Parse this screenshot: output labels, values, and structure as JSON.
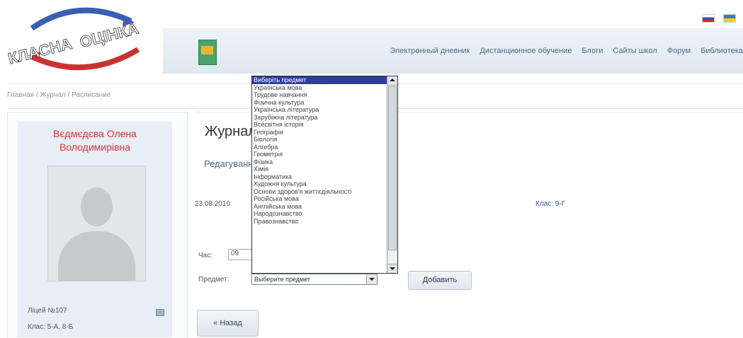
{
  "header": {
    "logo_text": [
      "КЛАСНА",
      "ОЦІНКА"
    ],
    "nav": [
      "Электронный дневник",
      "Дистанционное обучение",
      "Блоги",
      "Сайты школ",
      "Форум",
      "Библиотека"
    ]
  },
  "breadcrumb": "Главная / Журнал / Расписание",
  "profile": {
    "name": "Вєдмєдєва Олена Володимирівна",
    "school": "Ліцей №107",
    "classes": "Клас: 5-А, 8-Б"
  },
  "main": {
    "title": "Журнал",
    "subtitle": "Редагування",
    "date": "23.08.2010",
    "class_label": "Клас: 9-Г",
    "time_label": "Час:",
    "time_value": "09",
    "subject_label": "Предмет:",
    "subject_selected": "Выберите предмет",
    "add_button": "Добавить",
    "back_button": "« Назад"
  },
  "dropdown": {
    "options": [
      "Виберіть предмет",
      "Українська мова",
      "Трудове навчання",
      "Фізична культура",
      "Українська література",
      "Зарубіжна література",
      "Всесвітня історія",
      "Географія",
      "Біологія",
      "Алгебра",
      "Геометрія",
      "Фізика",
      "Хімія",
      "Інформатика",
      "Художня культура",
      "Основи здоров'я життєдіяльності",
      "Російська мова",
      "Англійська мова",
      "Народознавство",
      "Правознавство"
    ],
    "selected_index": 0
  },
  "colors": {
    "profile_name": "#dd3333",
    "link": "#4a6a88",
    "selected_option": "#2c3fa0"
  }
}
